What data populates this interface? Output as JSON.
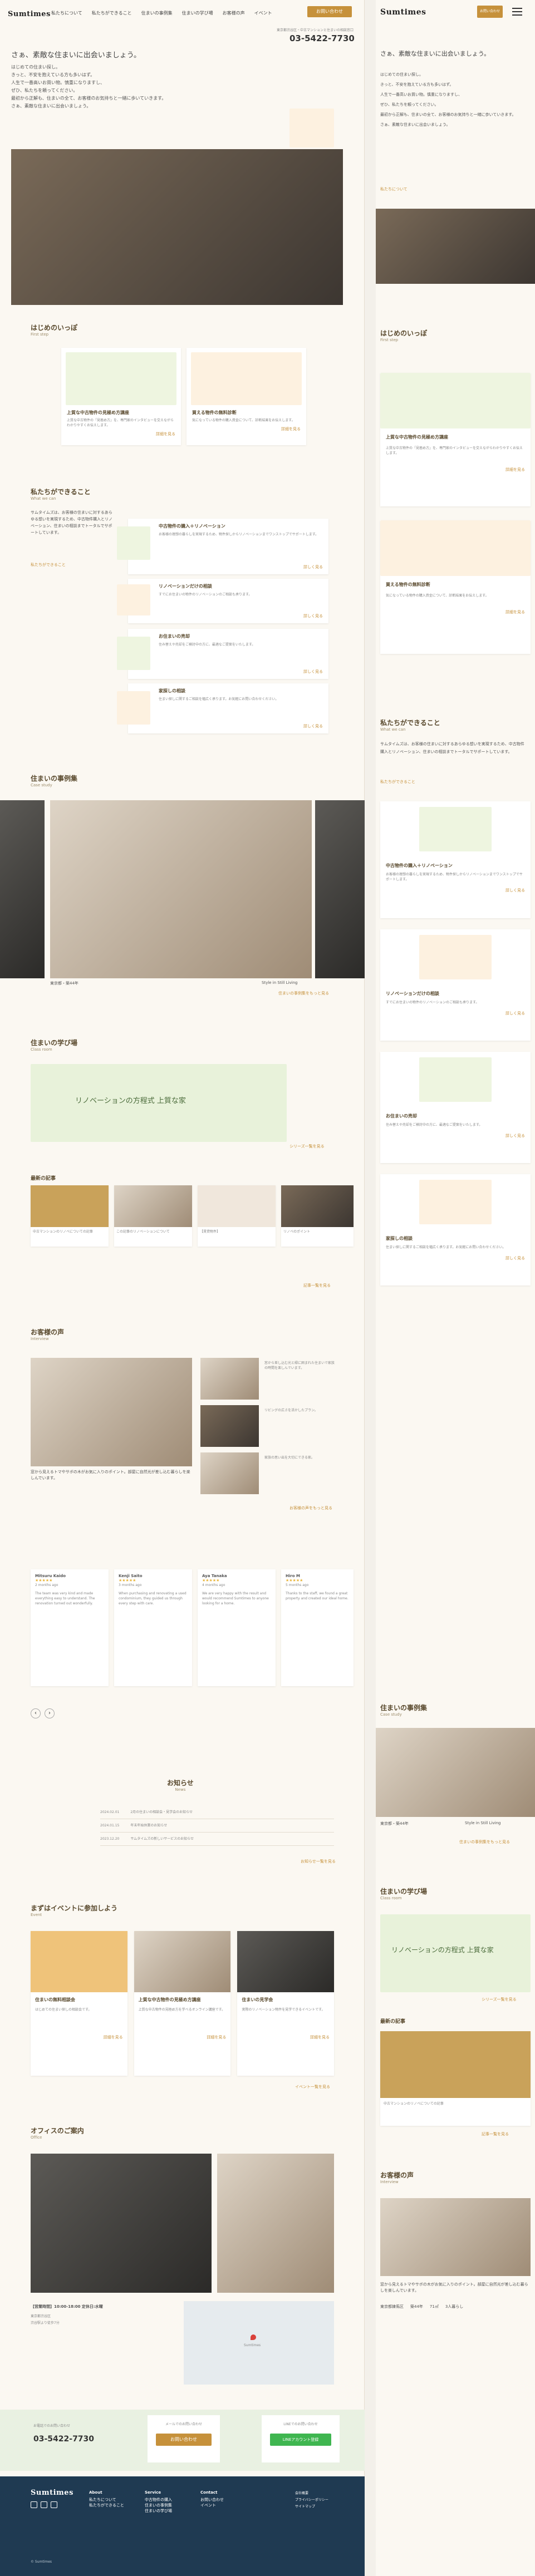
{
  "brand": {
    "name": "Sumtimes",
    "tel": "03-5422-7730",
    "tel_note": "東京都渋谷区・中古マンションと住まいの相談窓口"
  },
  "nav": {
    "items": [
      "私たちについて",
      "私たちができること",
      "住まいの事例集",
      "住まいの学び場",
      "お客様の声",
      "イベント"
    ],
    "contact": "お問い合わせ"
  },
  "hero": {
    "lead": "さぁ、素敵な住まいに出会いましょう。",
    "body": [
      "はじめての住まい探し。",
      "きっと、不安を抱えている方も多いはず。",
      "人生で一番高いお買い物。慎重になりますし、",
      "ぜひ、私たちを頼ってください。",
      "最初から正解も、住まいの全て、お客様のお気持ちと一緒に歩いていきます。",
      "さぁ、素敵な住まいに出会いましょう。"
    ],
    "link": "私たちについて"
  },
  "first_step": {
    "title": "はじめのいっぽ",
    "sub": "First step",
    "cards": [
      {
        "title": "上質な中古物件の見極め方講座",
        "text": "上質な中古物件の「見極め方」を、専門家のインタビューを交えながらわかりやすくお伝えします。",
        "link": "詳細を見る"
      },
      {
        "title": "買える物件の無料診断",
        "text": "気になっている物件の購入資金について、診断結果をお伝えします。",
        "link": "詳細を見る"
      }
    ]
  },
  "what": {
    "title": "私たちができること",
    "sub": "What we can",
    "text": "サムタイムズは、お客様の住まいに対するあらゆる想いを実現するため、中古物件購入とリノベーション、住まいの相談までトータルでサポートしています。",
    "link": "私たちができること",
    "items": [
      {
        "title": "中古物件の購入＋リノベーション",
        "text": "お客様の理想の暮らしを実現するため、物件探しからリノベーションまでワンストップでサポートします。",
        "link": "詳しく見る"
      },
      {
        "title": "リノベーションだけの相談",
        "text": "すでにお住まいの物件のリノベーションのご相談も承ります。",
        "link": "詳しく見る"
      },
      {
        "title": "お住まいの売却",
        "text": "住み替えや売却をご検討中の方に、最適なご提案をいたします。",
        "link": "詳しく見る"
      },
      {
        "title": "家探しの相談",
        "text": "住まい探しに関するご相談を幅広く承ります。お気軽にお問い合わせください。",
        "link": "詳しく見る"
      }
    ]
  },
  "cases": {
    "title": "住まいの事例集",
    "sub": "Case study",
    "captions": [
      "東京都・築44年",
      "Style in Still Living"
    ],
    "link": "住まいの事例集をもっと見る"
  },
  "learn": {
    "title": "住まいの学び場",
    "sub": "Class room",
    "banner": "リノベーションの方程式 上質な家",
    "link": "シリーズ一覧を見る",
    "recent_title": "最新の記事",
    "articles": [
      "中古マンションのリノベについての記事",
      "この記事のリノベーションについて",
      "【賃貸物件】",
      "リノベのポイント"
    ],
    "articles_link": "記事一覧を見る"
  },
  "voice": {
    "title": "お客様の声",
    "sub": "Interview",
    "quote": "窓から見えるトマやサボの木がお気に入りのポイント。部屋に自然光が差し込む暮らしを楽しんでいます。",
    "meta": [
      "東京都練馬区",
      "築44年",
      "71㎡",
      "3人暮らし"
    ],
    "link": "お客様の声をもっと見る",
    "side_texts": [
      "窓から差し込む光と緑に囲まれた住まいで家族の時間を楽しんでいます。",
      "リビングの広さを活かしたプラン。",
      "家族の思い出を大切にできる家。"
    ]
  },
  "reviews": {
    "items": [
      {
        "name": "Mitsuru Kaido",
        "date": "2 months ago",
        "text": "The team was very kind and made everything easy to understand. The renovation turned out wonderfully."
      },
      {
        "name": "Kenji Saito",
        "date": "3 months ago",
        "text": "When purchasing and renovating a used condominium, they guided us through every step with care."
      },
      {
        "name": "Aya Tanaka",
        "date": "4 months ago",
        "text": "We are very happy with the result and would recommend Sumtimes to anyone looking for a home."
      },
      {
        "name": "Hiro M",
        "date": "5 months ago",
        "text": "Thanks to the staff, we found a great property and created our ideal home."
      }
    ],
    "prev": "‹",
    "next": "›"
  },
  "news": {
    "title": "お知らせ",
    "sub": "News",
    "items": [
      {
        "date": "2024.02.01",
        "text": "2月の住まいの相談会・見学会のお知らせ"
      },
      {
        "date": "2024.01.15",
        "text": "年末年始休業のお知らせ"
      },
      {
        "date": "2023.12.20",
        "text": "サムタイムズの新しいサービスのお知らせ"
      }
    ],
    "link": "お知らせ一覧を見る"
  },
  "events": {
    "title": "まずはイベントに参加しよう",
    "sub": "Event",
    "cards": [
      {
        "title": "住まいの無料相談会",
        "text": "はじめての住まい探しの相談会です。",
        "link": "詳細を見る"
      },
      {
        "title": "上質な中古物件の見極め方講座",
        "text": "上質な中古物件の見極め方を学べるオンライン講座です。",
        "link": "詳細を見る"
      },
      {
        "title": "住まいの見学会",
        "text": "実際のリノベーション物件を見学できるイベントです。",
        "link": "詳細を見る"
      }
    ],
    "link": "イベント一覧を見る"
  },
  "office": {
    "title": "オフィスのご案内",
    "sub": "Office",
    "hours": "【営業時間】10:00-18:00 定休日:水曜",
    "address": "東京都渋谷区",
    "access": "渋谷駅より徒歩7分",
    "map_label": "Sumtimes"
  },
  "cta": {
    "tel_label": "お電話でのお問い合わせ",
    "tel": "03-5422-7730",
    "mail_label": "メールでのお問い合わせ",
    "mail_btn": "お問い合わせ",
    "line_label": "LINEでのお問い合わせ",
    "line_btn": "LINEアカウント登録"
  },
  "footer": {
    "cols": [
      {
        "head": "About",
        "items": [
          "私たちについて",
          "私たちができること"
        ]
      },
      {
        "head": "Service",
        "items": [
          "中古物件の購入",
          "住まいの事例集",
          "住まいの学び場"
        ]
      },
      {
        "head": "Contact",
        "items": [
          "お問い合わせ",
          "イベント"
        ]
      }
    ],
    "links": [
      "会社概要",
      "プライバシーポリシー",
      "サイトマップ"
    ],
    "copy": "© Sumtimes"
  },
  "colors": {
    "accent": "#c6913b",
    "green": "#3fb650",
    "navy": "#1f3a52"
  }
}
